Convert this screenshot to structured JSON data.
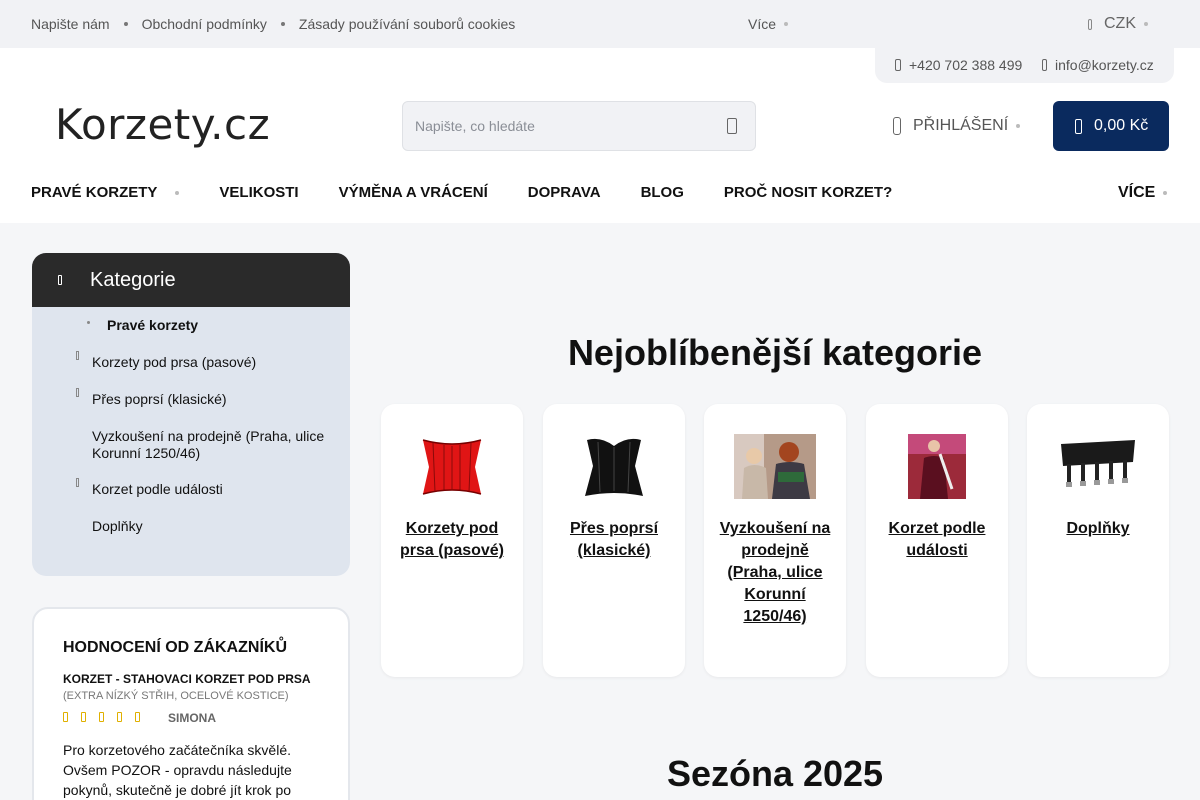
{
  "topbar": {
    "links": [
      "Napište nám",
      "Obchodní podmínky",
      "Zásady používání souborů cookies"
    ],
    "more_label": "Více",
    "currency": "CZK"
  },
  "contact": {
    "phone": "+420 702 388 499",
    "email": "info@korzety.cz"
  },
  "header": {
    "logo_text": "Korzety.cz",
    "search_placeholder": "Napište, co hledáte",
    "login_label": "PŘIHLÁŠENÍ",
    "cart_total": "0,00 Kč"
  },
  "nav": {
    "items": [
      "PRAVÉ KORZETY",
      "VELIKOSTI",
      "VÝMĚNA A VRÁCENÍ",
      "DOPRAVA",
      "BLOG",
      "PROČ NOSIT KORZET?"
    ],
    "more_label": "VÍCE"
  },
  "sidebar": {
    "title": "Kategorie",
    "root": "Pravé korzety",
    "items": [
      "Korzety pod prsa (pasové)",
      "Přes poprsí (klasické)",
      "Vyzkoušení na prodejně (Praha, ulice Korunní 1250/46)",
      "Korzet podle události",
      "Doplňky"
    ]
  },
  "reviews": {
    "title": "HODNOCENÍ OD ZÁKAZNÍKŮ",
    "product": "KORZET - STAHOVACI KORZET POD PRSA",
    "variant": "(EXTRA NÍZKÝ STŘIH, OCELOVÉ KOSTICE)",
    "rating": 5,
    "author": "SIMONA",
    "text": "Pro korzetového začátečníka skvělé. Ovšem POZOR - opravdu následujte pokynů, skutečně je dobré jít krok po"
  },
  "main": {
    "popular_title": "Nejoblíbenější kategorie",
    "cards": [
      "Korzety pod prsa (pasové)",
      "Přes poprsí (klasické)",
      "Vyzkoušení na prodejně (Praha, ulice Korunní 1250/46)",
      "Korzet podle události",
      "Doplňky"
    ],
    "season_title": "Sezóna 2025"
  },
  "colors": {
    "cart_bg": "#0a2a5e",
    "category_header": "#2a2a2a",
    "category_bg": "#dfe5ee"
  }
}
